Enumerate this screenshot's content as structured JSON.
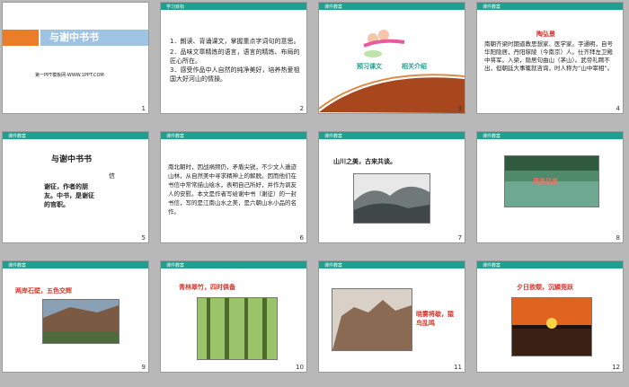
{
  "brand": {
    "tag": "课件教案"
  },
  "slide1": {
    "title": "与谢中书书",
    "site": "第一PPT模板网-WWW.1PPT.COM",
    "num": "1"
  },
  "slide2": {
    "tag": "学习目标",
    "num": "2",
    "items": [
      "1．朗读、背诵课文，掌握重点字词句的意思。",
      "2．品味文章精炼的语言，语言的精炼、布局的匠心所在。",
      "3．感受作品中人自然的纯净美好，培养热爱祖国大好河山的情操。"
    ]
  },
  "slide3": {
    "tag": "",
    "num": "3",
    "caption1": "预习课文",
    "caption2": "相关介绍"
  },
  "slide4": {
    "num": "4",
    "heading": "陶弘景",
    "body": "南朝齐梁时期道教思想家、医学家。字通明，自号华阳隐居，丹阳秣陵（今南京）人。仕齐拜左卫殿中将军。入梁，隐居句曲山（茅山）。武帝礼聘不出，但朝廷大事辄就咨询，时人称为“山中宰相”。"
  },
  "slide5": {
    "num": "5",
    "title": "与谢中书书",
    "tail": "信",
    "body": "谢征，作者的朋友。中书，是谢征的官职。"
  },
  "slide6": {
    "num": "6",
    "body": "南北朝时，因战祸频仍，矛盾尖锐，不少文人遁迹山林，从自然美中寻求精神上的解脱。因而他们在书信中常常描山绘水，表明自己所好，并作为讽友人的安慰。本文是作者写给谢中书（谢征）的一封书信，写的是江南山水之美，是六朝山水小品的名作。"
  },
  "slide7": {
    "num": "7",
    "caption": "山川之美，古来共谈。"
  },
  "slide8": {
    "num": "8",
    "caption": "清流见底"
  },
  "slide9": {
    "num": "9",
    "caption": "两岸石壁，五色交辉"
  },
  "slide10": {
    "num": "10",
    "caption": "青林翠竹，四时俱备"
  },
  "slide11": {
    "num": "11",
    "caption": "晓雾将歇，猿鸟乱鸣"
  },
  "slide12": {
    "num": "12",
    "caption": "夕日欲颓，沉鳞竞跃"
  }
}
